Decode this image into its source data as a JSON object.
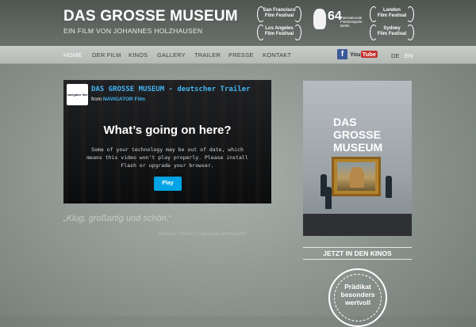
{
  "header": {
    "title": "DAS GROSSE MUSEUM",
    "subtitle": "EIN FILM VON JOHANNES HOLZHAUSEN",
    "festivals": [
      {
        "line1": "San Francisco",
        "line2": "Film Festival"
      },
      {
        "line1": "Los Angeles",
        "line2": "Film Festival"
      },
      {
        "line1": "London",
        "line2": "Film Festival"
      },
      {
        "line1": "Sydney",
        "line2": "Film Festival"
      }
    ],
    "berlinale": {
      "number": "64",
      "line1": "Internationale",
      "line2": "Filmfestspiele",
      "line3": "Berlin"
    }
  },
  "nav": {
    "items": [
      "HOME",
      "DER FILM",
      "KINOS",
      "GALLERY",
      "TRAILER",
      "PRESSE",
      "KONTAKT"
    ],
    "facebook": "f",
    "youtube": {
      "you": "You",
      "tube": "Tube"
    },
    "languages": [
      "DE",
      "EN"
    ]
  },
  "video": {
    "logo_text": "navigator film",
    "title": "DAS GROSSE MUSEUM - deutscher Trailer",
    "from_prefix": "from",
    "author": "NAVIGATOR Film",
    "heading": "What’s going on here?",
    "message": "Some of your technology may be out of date, which means this video won't play properly. Please install Flash or upgrade your browser.",
    "play_label": "Play"
  },
  "quote": {
    "text": "„Klug, großartig und schön.“",
    "attribution": "Barbara Pichler, Diagonale-Intendantin"
  },
  "poster": {
    "title_line1": "DAS",
    "title_line2": "GROSSE",
    "title_line3": "MUSEUM"
  },
  "sidebar": {
    "now_in_cinemas": "JETZT IN DEN KINOS",
    "seal": {
      "line1": "Prädikat",
      "line2": "besonders",
      "line3": "wertvoll"
    }
  },
  "colors": {
    "accent": "#44b5f2",
    "play_button": "#00a4e4",
    "facebook": "#3b5998",
    "youtube": "#c4302b"
  }
}
